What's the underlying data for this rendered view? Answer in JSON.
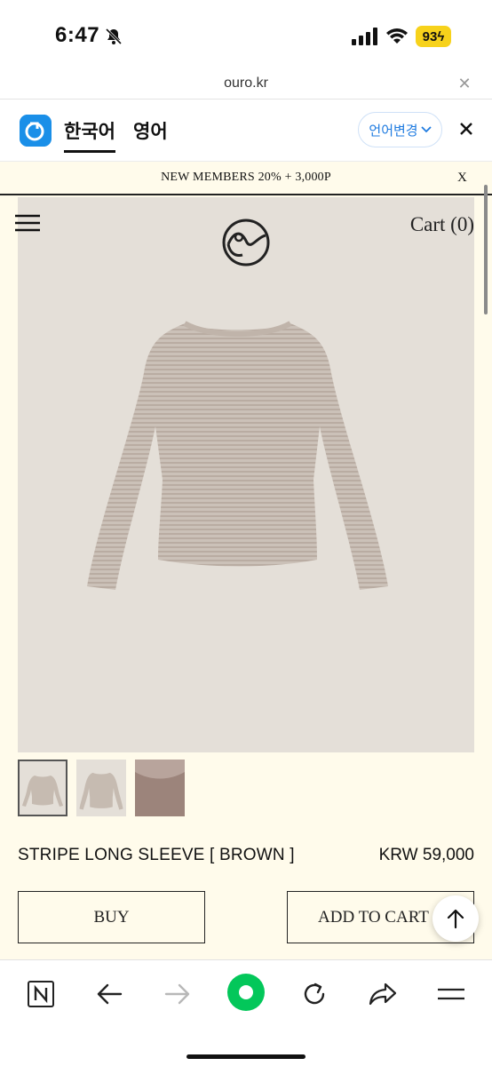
{
  "status_bar": {
    "time": "6:47",
    "battery": "93",
    "icons": [
      "bell-off-icon",
      "signal-icon",
      "wifi-icon",
      "battery-icon"
    ]
  },
  "url_bar": {
    "domain": "ouro.kr",
    "close_icon": "close-icon"
  },
  "translate_bar": {
    "tabs": [
      "한국어",
      "영어"
    ],
    "active_tab": "한국어",
    "change_language_label": "언어변경",
    "accent": "#1f7be0"
  },
  "promo_banner": {
    "text": "NEW MEMBERS 20% + 3,000P",
    "close_label": "X"
  },
  "header": {
    "cart_label": "Cart (0)",
    "menu_icon": "hamburger-menu-icon",
    "logo_icon": "ouro-logo-icon"
  },
  "product": {
    "name": "STRIPE LONG SLEEVE [ BROWN ]",
    "price": "KRW 59,000",
    "thumbnails": [
      "front-view",
      "front-view-alt",
      "fabric-detail"
    ],
    "selected_thumbnail": 0,
    "buy_label": "BUY",
    "add_to_cart_label": "ADD TO CART"
  },
  "colors": {
    "page_background": "#fffbeb",
    "image_background": "#e4dfd8",
    "primary_green": "#03c75a"
  },
  "toolbar": {
    "items": [
      "naver-n-icon",
      "back-arrow-icon",
      "forward-arrow-icon",
      "green-dot-icon",
      "reload-icon",
      "share-icon",
      "menu-icon"
    ]
  }
}
